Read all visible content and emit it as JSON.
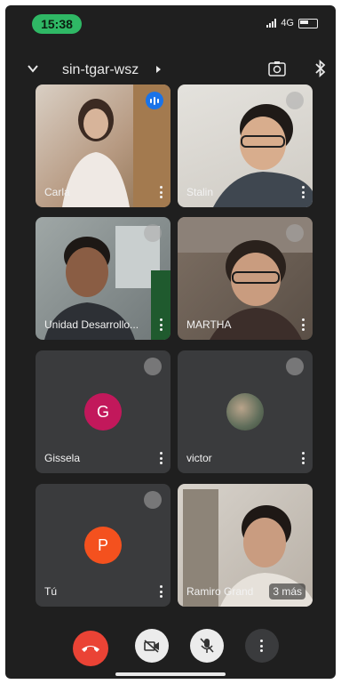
{
  "status_bar": {
    "time": "15:38",
    "network": "4G"
  },
  "header": {
    "meeting_name": "sin-tgar-wsz"
  },
  "participants": [
    {
      "name": "Carla"
    },
    {
      "name": "Stalin"
    },
    {
      "name": "Unidad Desarrollo..."
    },
    {
      "name": "MARTHA"
    },
    {
      "name": "Gissela",
      "initial": "G",
      "avatar_color": "#c2185b"
    },
    {
      "name": "victor"
    },
    {
      "name": "Tú",
      "initial": "P",
      "avatar_color": "#f4511e"
    },
    {
      "name": "Ramiro Grand",
      "more_label": "3 más"
    }
  ],
  "colors": {
    "end_call": "#ea4335",
    "speaking": "#1a73e8"
  }
}
